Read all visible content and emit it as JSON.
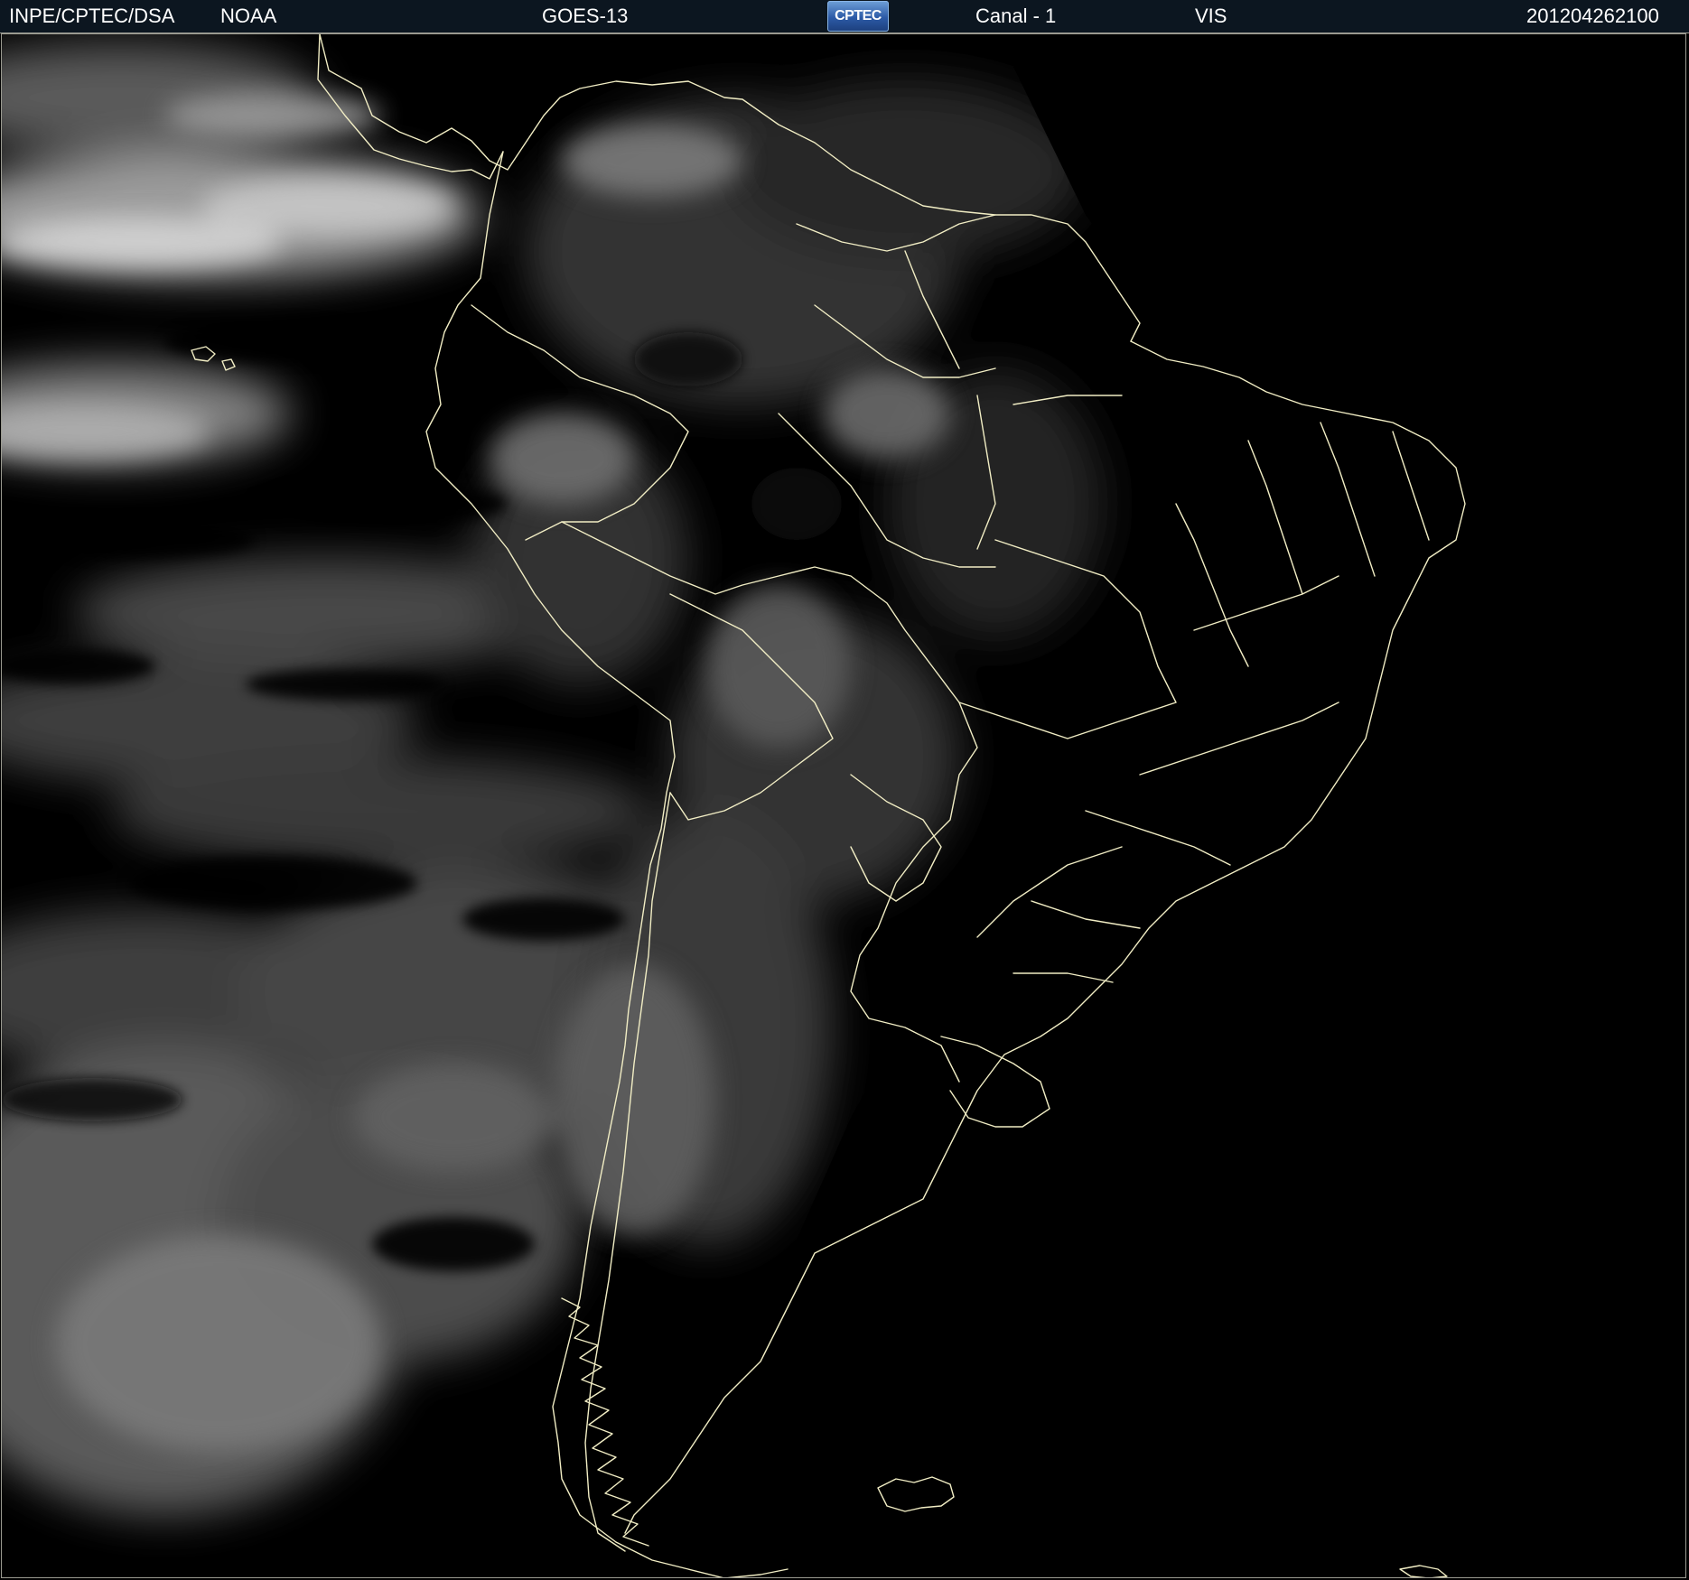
{
  "header": {
    "agency": "INPE/CPTEC/DSA",
    "source": "NOAA",
    "satellite": "GOES-13",
    "logo_text": "CPTEC",
    "channel": "Canal - 1",
    "band": "VIS",
    "timestamp": "201204262100"
  },
  "colors": {
    "header_bg": "#0c1620",
    "header_text": "#ffffff",
    "background": "#000000",
    "boundary_lines": "#f1edc4",
    "cloud_tone": "#8c8c8c"
  },
  "map": {
    "type": "satellite visible-channel image",
    "region": "South America",
    "icon": "globe-icon"
  }
}
